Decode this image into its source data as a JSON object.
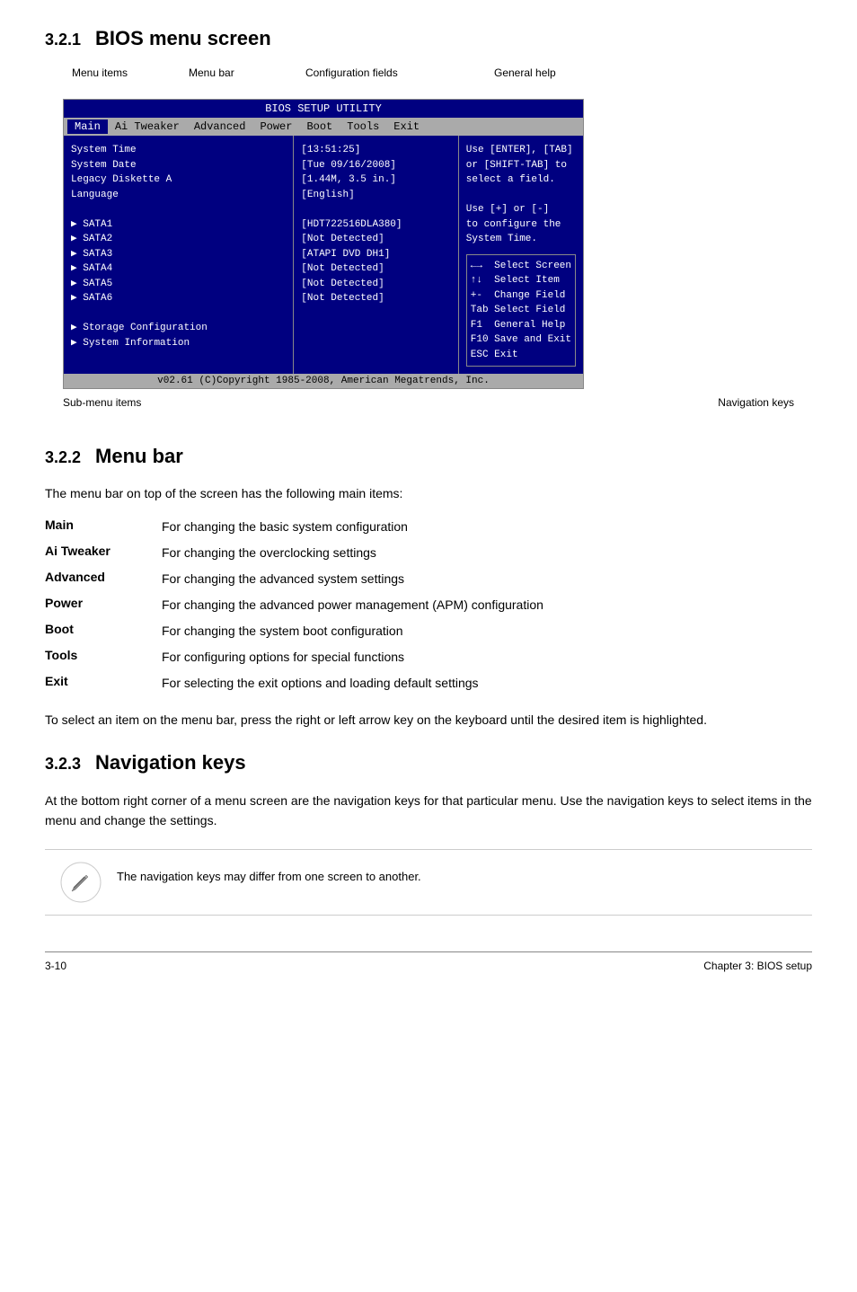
{
  "sections": {
    "s321": {
      "number": "3.2.1",
      "title": "BIOS menu screen"
    },
    "s322": {
      "number": "3.2.2",
      "title": "Menu bar"
    },
    "s323": {
      "number": "3.2.3",
      "title": "Navigation keys"
    }
  },
  "bios": {
    "title": "BIOS SETUP UTILITY",
    "menu_items": [
      {
        "label": "Main",
        "active": true
      },
      {
        "label": "Ai Tweaker",
        "active": false
      },
      {
        "label": "Advanced",
        "active": false
      },
      {
        "label": "Power",
        "active": false
      },
      {
        "label": "Boot",
        "active": false
      },
      {
        "label": "Tools",
        "active": false
      },
      {
        "label": "Exit",
        "active": false
      }
    ],
    "left_panel": [
      "System Time",
      "System Date",
      "Legacy Diskette A",
      "Language",
      "",
      "▶ SATA1",
      "▶ SATA2",
      "▶ SATA3",
      "▶ SATA4",
      "▶ SATA5",
      "▶ SATA6",
      "",
      "▶ Storage Configuration",
      "▶ System Information"
    ],
    "center_panel": [
      "[13:51:25]",
      "[Tue 09/16/2008]",
      "[1.44M, 3.5 in.]",
      "[English]",
      "",
      "[HDT722516DLA380]",
      "[Not Detected]",
      "[ATAPI DVD DH1]",
      "[Not Detected]",
      "[Not Detected]",
      "[Not Detected]"
    ],
    "right_panel_top": [
      "Use [ENTER], [TAB]",
      "or [SHIFT-TAB] to",
      "select a field.",
      "",
      "Use [+] or [-]",
      "to configure the",
      "System Time."
    ],
    "right_panel_nav": [
      "←→   Select Screen",
      "↑↓   Select Item",
      "+-   Change Field",
      "Tab  Select Field",
      "F1   General Help",
      "F10  Save and Exit",
      "ESC  Exit"
    ],
    "footer": "v02.61 (C)Copyright 1985-2008, American Megatrends, Inc."
  },
  "diagram_labels": {
    "menu_items": "Menu items",
    "menu_bar": "Menu bar",
    "config_fields": "Configuration fields",
    "general_help": "General help",
    "sub_menu_items": "Sub-menu items",
    "navigation_keys": "Navigation keys"
  },
  "section322": {
    "intro": "The menu bar on top of the screen has the following main items:",
    "items": [
      {
        "label": "Main",
        "desc": "For changing the basic system configuration"
      },
      {
        "label": "Ai Tweaker",
        "desc": "For changing the overclocking settings"
      },
      {
        "label": "Advanced",
        "desc": "For changing the advanced system settings"
      },
      {
        "label": "Power",
        "desc": "For changing the advanced power management (APM) configuration"
      },
      {
        "label": "Boot",
        "desc": "For changing the system boot configuration"
      },
      {
        "label": "Tools",
        "desc": "For configuring options for special functions"
      },
      {
        "label": "Exit",
        "desc": "For selecting the exit options and loading default settings"
      }
    ],
    "footer_text": "To select an item on the menu bar, press the right or left arrow key on the keyboard until the desired item is highlighted."
  },
  "section323": {
    "body": "At the bottom right corner of a menu screen are the navigation keys for that particular menu. Use the navigation keys to select items in the menu and change the settings."
  },
  "note": {
    "text": "The navigation keys may differ from one screen to another."
  },
  "page_footer": {
    "left": "3-10",
    "right": "Chapter 3: BIOS setup"
  }
}
